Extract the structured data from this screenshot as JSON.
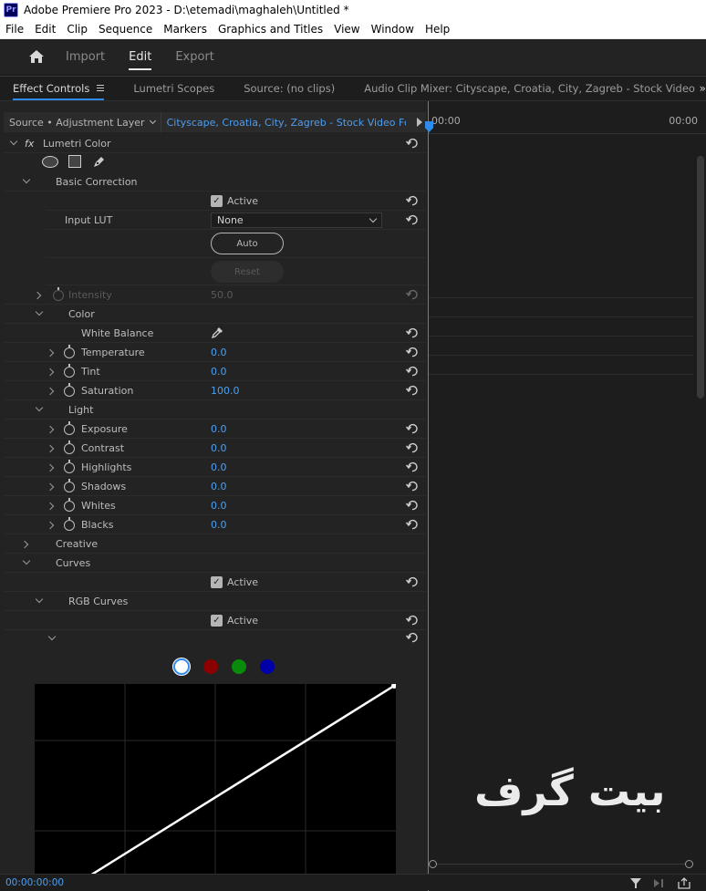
{
  "window": {
    "title": "Adobe Premiere Pro 2023 - D:\\etemadi\\maghaleh\\Untitled *",
    "app_icon": "Pr"
  },
  "menu": [
    "File",
    "Edit",
    "Clip",
    "Sequence",
    "Markers",
    "Graphics and Titles",
    "View",
    "Window",
    "Help"
  ],
  "nav": {
    "import": "Import",
    "edit": "Edit",
    "export": "Export"
  },
  "tabs": {
    "effect_controls": "Effect Controls",
    "lumetri_scopes": "Lumetri Scopes",
    "source": "Source: (no clips)",
    "audio_mixer": "Audio Clip Mixer: Cityscape, Croatia, City, Zagreb - Stock Video Footage - Artgri"
  },
  "source_row": {
    "source": "Source • Adjustment Layer",
    "clip": "Cityscape, Croatia, City, Zagreb - Stock Video Foota..."
  },
  "timeline": {
    "start_tc": "00:00",
    "end_tc": "00:00"
  },
  "effect": {
    "fx": "fx",
    "name": "Lumetri Color"
  },
  "basic": {
    "title": "Basic Correction",
    "active": "Active",
    "input_lut_label": "Input LUT",
    "input_lut_value": "None",
    "auto": "Auto",
    "reset": "Reset",
    "intensity_label": "Intensity",
    "intensity_value": "50.0"
  },
  "color": {
    "title": "Color",
    "white_balance": "White Balance",
    "params": [
      {
        "label": "Temperature",
        "value": "0.0"
      },
      {
        "label": "Tint",
        "value": "0.0"
      },
      {
        "label": "Saturation",
        "value": "100.0"
      }
    ]
  },
  "light": {
    "title": "Light",
    "params": [
      {
        "label": "Exposure",
        "value": "0.0"
      },
      {
        "label": "Contrast",
        "value": "0.0"
      },
      {
        "label": "Highlights",
        "value": "0.0"
      },
      {
        "label": "Shadows",
        "value": "0.0"
      },
      {
        "label": "Whites",
        "value": "0.0"
      },
      {
        "label": "Blacks",
        "value": "0.0"
      }
    ]
  },
  "creative": {
    "title": "Creative"
  },
  "curves": {
    "title": "Curves",
    "active": "Active",
    "rgb_title": "RGB Curves",
    "rgb_active": "Active"
  },
  "channel_colors": {
    "white": "#ffffff",
    "red": "#8b0000",
    "green": "#0a8a0a",
    "blue": "#0000a8"
  },
  "watermark": "بیت گرف",
  "status": {
    "timecode": "00:00:00:00"
  }
}
